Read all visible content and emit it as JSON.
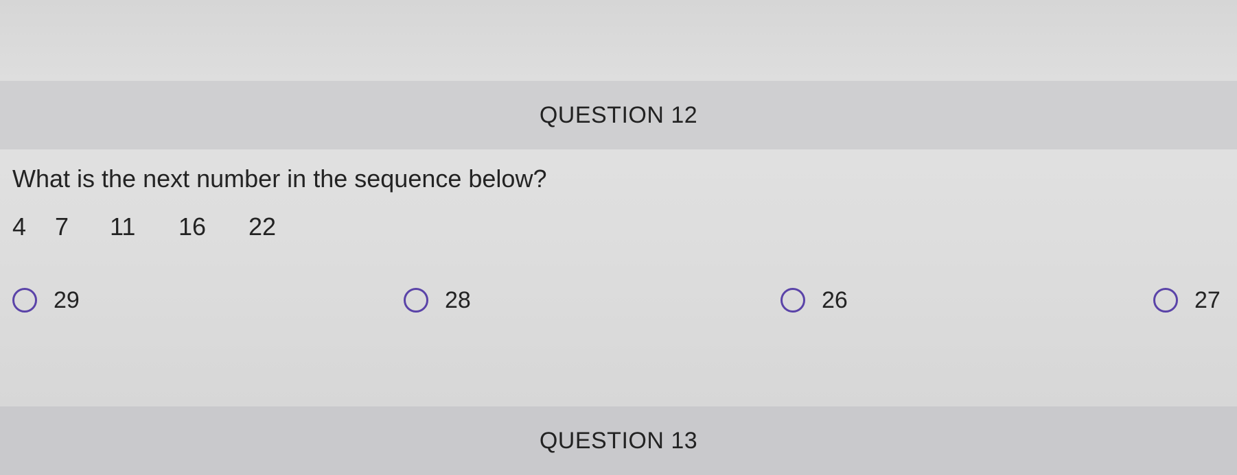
{
  "questions": [
    {
      "label": "QUESTION 12",
      "prompt": "What is the next number in the sequence below?",
      "sequence": [
        "4",
        "7",
        "11",
        "16",
        "22"
      ],
      "options": [
        "29",
        "28",
        "26",
        "27"
      ]
    },
    {
      "label": "QUESTION 13"
    }
  ],
  "colors": {
    "radio_border": "#5a43a8",
    "header_band": "#cfcfd1",
    "text": "#232323"
  }
}
